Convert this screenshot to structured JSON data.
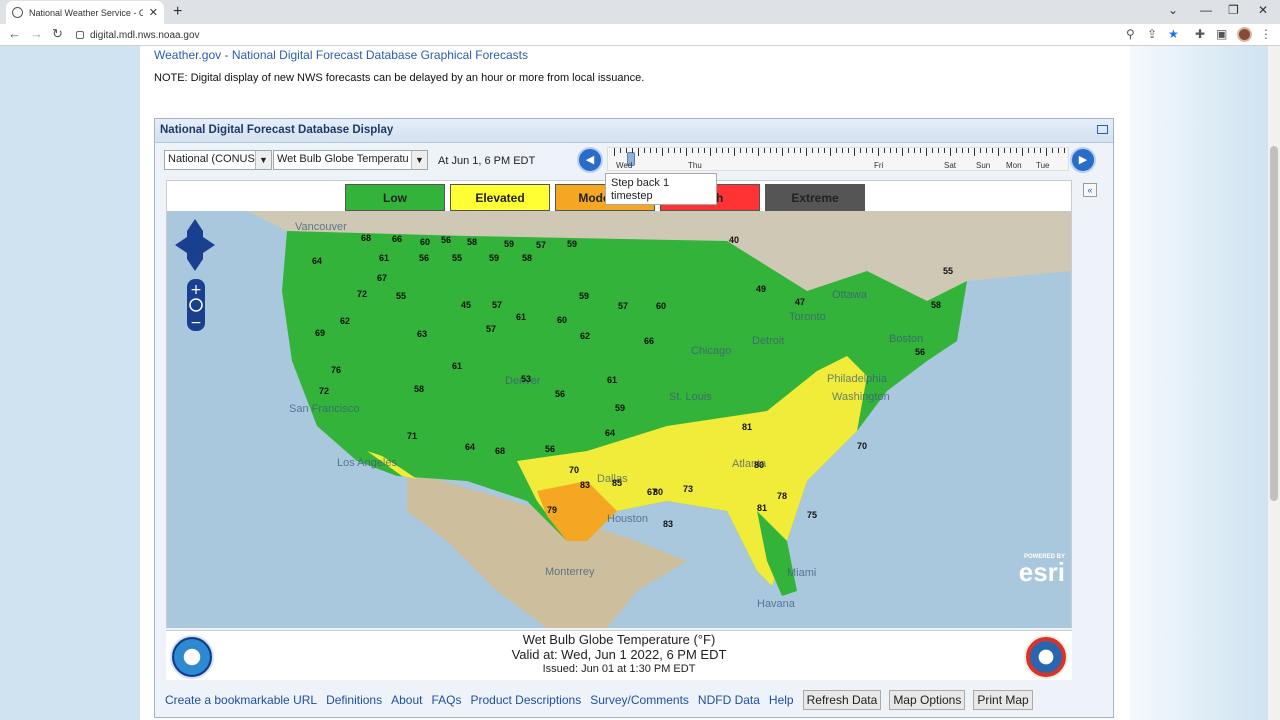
{
  "browser": {
    "tab_title": "National Weather Service - Grap",
    "url": "digital.mdl.nws.noaa.gov"
  },
  "page": {
    "header_link": "Weather.gov - National Digital Forecast Database Graphical Forecasts",
    "note": "NOTE: Digital display of new NWS forecasts can be delayed by an hour or more from local issuance."
  },
  "panel": {
    "title": "National Digital Forecast Database Display",
    "region_select": "National (CONUS",
    "element_select": "Wet Bulb Globe Temperatu",
    "at_label": "At Jun   1,   6 PM EDT",
    "timeline_days": [
      "Wed",
      "Thu",
      "Fri",
      "Sat",
      "Sun",
      "Mon",
      "Tue"
    ],
    "timeline_position": 0.03,
    "tooltip": "Step back 1 timestep",
    "step_back_icon": "step-back-icon",
    "step_forward_icon": "step-forward-icon"
  },
  "legend": {
    "items": [
      {
        "label": "Low",
        "color": "#33b33a"
      },
      {
        "label": "Elevated",
        "color": "#ffff33"
      },
      {
        "label": "Moderate",
        "color": "#f5a623"
      },
      {
        "label": "High",
        "color": "#ff3333"
      },
      {
        "label": "Extreme",
        "color": "#555555"
      }
    ]
  },
  "map": {
    "cities": [
      "Vancouver",
      "Ottawa",
      "Toronto",
      "Chicago",
      "Detroit",
      "Boston",
      "Philadelphia",
      "Washington",
      "Denver",
      "St. Louis",
      "San Francisco",
      "Los Angeles",
      "Dallas",
      "Houston",
      "Atlanta",
      "Miami",
      "Monterrey",
      "Havana"
    ],
    "esri_powered": "POWERED BY",
    "esri": "esri",
    "values": [
      {
        "v": "68"
      },
      {
        "v": "66"
      },
      {
        "v": "60"
      },
      {
        "v": "56"
      },
      {
        "v": "58"
      },
      {
        "v": "59"
      },
      {
        "v": "57"
      },
      {
        "v": "59"
      },
      {
        "v": "64"
      },
      {
        "v": "61"
      },
      {
        "v": "56"
      },
      {
        "v": "55"
      },
      {
        "v": "59"
      },
      {
        "v": "58"
      },
      {
        "v": "40"
      },
      {
        "v": "67"
      },
      {
        "v": "72"
      },
      {
        "v": "55"
      },
      {
        "v": "45"
      },
      {
        "v": "57"
      },
      {
        "v": "59"
      },
      {
        "v": "57"
      },
      {
        "v": "60"
      },
      {
        "v": "69"
      },
      {
        "v": "62"
      },
      {
        "v": "63"
      },
      {
        "v": "57"
      },
      {
        "v": "61"
      },
      {
        "v": "60"
      },
      {
        "v": "62"
      },
      {
        "v": "66"
      },
      {
        "v": "72"
      },
      {
        "v": "58"
      },
      {
        "v": "61"
      },
      {
        "v": "53"
      },
      {
        "v": "61"
      },
      {
        "v": "56"
      },
      {
        "v": "59"
      },
      {
        "v": "64"
      },
      {
        "v": "76"
      },
      {
        "v": "71"
      },
      {
        "v": "64"
      },
      {
        "v": "68"
      },
      {
        "v": "56"
      },
      {
        "v": "70"
      },
      {
        "v": "67"
      },
      {
        "v": "73"
      },
      {
        "v": "81"
      },
      {
        "v": "80"
      },
      {
        "v": "79"
      },
      {
        "v": "83"
      },
      {
        "v": "85"
      },
      {
        "v": "80"
      },
      {
        "v": "83"
      },
      {
        "v": "81"
      },
      {
        "v": "78"
      },
      {
        "v": "75"
      },
      {
        "v": "70"
      },
      {
        "v": "55"
      },
      {
        "v": "58"
      },
      {
        "v": "56"
      },
      {
        "v": "47"
      },
      {
        "v": "49"
      }
    ]
  },
  "footer": {
    "title": "Wet Bulb Globe Temperature (°F)",
    "valid": "Valid at: Wed, Jun   1 2022,   6 PM EDT",
    "issued": "Issued: Jun 01 at 1:30 PM EDT"
  },
  "links": {
    "items": [
      "Create a bookmarkable URL",
      "Definitions",
      "About",
      "FAQs",
      "Product Descriptions",
      "Survey/Comments",
      "NDFD Data",
      "Help"
    ],
    "buttons": [
      "Refresh Data",
      "Map Options",
      "Print Map"
    ]
  }
}
